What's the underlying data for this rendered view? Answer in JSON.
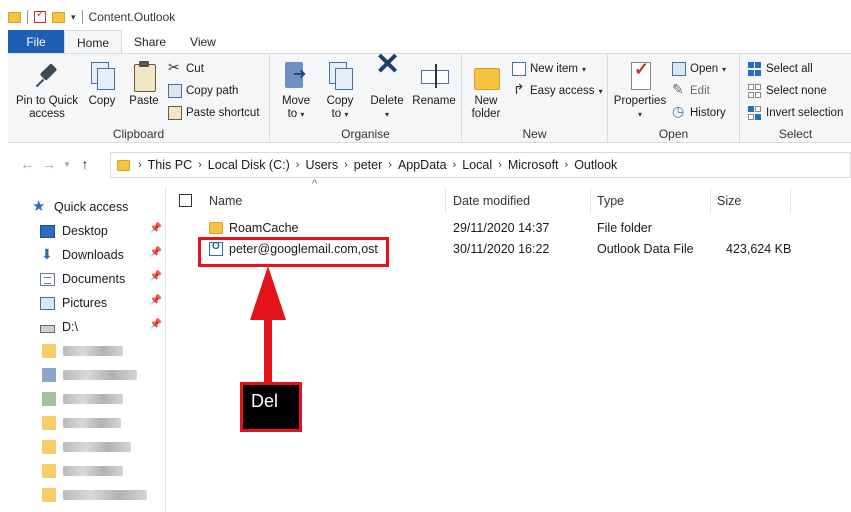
{
  "window": {
    "title": "Content.Outlook"
  },
  "tabs": [
    {
      "label": "File"
    },
    {
      "label": "Home"
    },
    {
      "label": "Share"
    },
    {
      "label": "View"
    }
  ],
  "ribbon": {
    "clipboard": {
      "group_label": "Clipboard",
      "pin_label_1": "Pin to Quick",
      "pin_label_2": "access",
      "copy_label": "Copy",
      "paste_label": "Paste",
      "cut_label": "Cut",
      "copy_path_label": "Copy path",
      "paste_shortcut_label": "Paste shortcut"
    },
    "organise": {
      "group_label": "Organise",
      "move_label": "Move",
      "move_to": "to",
      "copy_label": "Copy",
      "copy_to": "to",
      "delete_label": "Delete",
      "rename_label": "Rename"
    },
    "new": {
      "group_label": "New",
      "new_folder_1": "New",
      "new_folder_2": "folder",
      "new_item_label": "New item",
      "easy_access_label": "Easy access"
    },
    "open": {
      "group_label": "Open",
      "properties_label": "Properties",
      "open_label": "Open",
      "edit_label": "Edit",
      "history_label": "History"
    },
    "select": {
      "group_label": "Select",
      "select_all_label": "Select all",
      "select_none_label": "Select none",
      "invert_label": "Invert selection"
    }
  },
  "address": {
    "crumbs": [
      "This PC",
      "Local Disk (C:)",
      "Users",
      "peter",
      "AppData",
      "Local",
      "Microsoft",
      "Outlook"
    ]
  },
  "nav": {
    "quick_access": "Quick access",
    "items": [
      {
        "label": "Desktop",
        "icon": "desktop-icon"
      },
      {
        "label": "Downloads",
        "icon": "downloads-icon"
      },
      {
        "label": "Documents",
        "icon": "documents-icon"
      },
      {
        "label": "Pictures",
        "icon": "pictures-icon"
      },
      {
        "label": "D:\\",
        "icon": "drive-icon"
      }
    ]
  },
  "columns": {
    "name": "Name",
    "date": "Date modified",
    "type": "Type",
    "size": "Size"
  },
  "files": [
    {
      "name": "RoamCache",
      "date": "29/11/2020 14:37",
      "type": "File folder",
      "size": ""
    },
    {
      "name": "peter@googlemail.com,ost",
      "date": "30/11/2020 16:22",
      "type": "Outlook Data File",
      "size": "423,624 KB"
    }
  ],
  "annotation": {
    "label": "Del"
  },
  "colors": {
    "file_tab": "#1e5fb3",
    "annotation_red": "#e3141b",
    "folder_yellow": "#f5c343"
  }
}
